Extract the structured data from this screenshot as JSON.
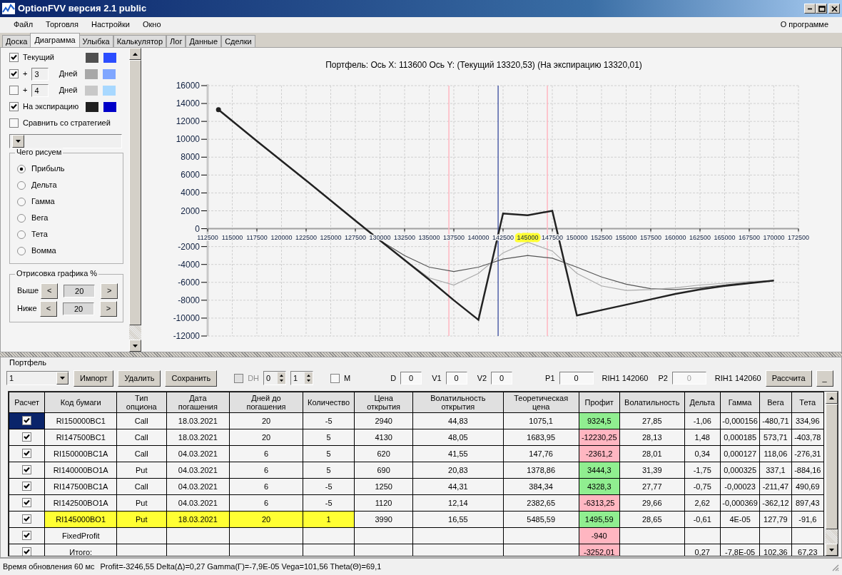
{
  "window": {
    "title": "OptionFVV версия 2.1 public"
  },
  "menu": [
    "Файл",
    "Торговля",
    "Настройки",
    "Окно"
  ],
  "menu_right": "О программе",
  "tabs": [
    {
      "label": "Доска",
      "selected": false
    },
    {
      "label": "Диаграмма",
      "selected": true
    },
    {
      "label": "Улыбка",
      "selected": false
    },
    {
      "label": "Калькулятор",
      "selected": false
    },
    {
      "label": "Лог",
      "selected": false
    },
    {
      "label": "Данные",
      "selected": false
    },
    {
      "label": "Сделки",
      "selected": false
    }
  ],
  "panel": {
    "rows": [
      {
        "kind": "series",
        "label": "Текущий",
        "checked": true,
        "swatches": [
          {
            "color": "#505050"
          },
          {
            "color": "#2b4dff"
          }
        ]
      },
      {
        "kind": "days",
        "prefix": "+",
        "days": "3",
        "label": "Дней",
        "checked": true,
        "swatches": [
          {
            "color": "#a8a8a8"
          },
          {
            "color": "#7fa6ff"
          }
        ]
      },
      {
        "kind": "days",
        "prefix": "+",
        "days": "4",
        "label": "Дней",
        "checked": false,
        "swatches": [
          {
            "color": "#c8c8c8"
          },
          {
            "color": "#a8d8ff"
          }
        ]
      },
      {
        "kind": "series",
        "label": "На экспирацию",
        "checked": true,
        "swatches": [
          {
            "color": "#202020"
          },
          {
            "color": "#0000c8"
          }
        ]
      },
      {
        "kind": "plain",
        "label": "Сравнить со стратегией",
        "checked": false
      }
    ],
    "draw_group": {
      "title": "Чего рисуем",
      "options": [
        {
          "label": "Прибыль",
          "selected": true
        },
        {
          "label": "Дельта",
          "selected": false
        },
        {
          "label": "Гамма",
          "selected": false
        },
        {
          "label": "Вега",
          "selected": false
        },
        {
          "label": "Тета",
          "selected": false
        },
        {
          "label": "Вомма",
          "selected": false
        }
      ]
    },
    "range_group": {
      "title": "Отрисовка графика %",
      "rows": [
        {
          "label": "Выше",
          "dec": "<",
          "value": "20",
          "inc": ">"
        },
        {
          "label": "Ниже",
          "dec": "<",
          "value": "20",
          "inc": ">"
        }
      ]
    }
  },
  "chart": {
    "chart_data": {
      "type": "line",
      "title": "Портфель: Ось X: 113600 Ось Y: (Текущий 13320,53) (На экспирацию 13320,01)",
      "x": [
        113600,
        117500,
        122500,
        127500,
        130000,
        132500,
        135000,
        137500,
        140000,
        142500,
        145000,
        147500,
        150000,
        152500,
        155000,
        157500,
        160000,
        162500,
        165000,
        167500,
        170000
      ],
      "series": [
        {
          "color": "#555555",
          "values": [
            13300,
            9800,
            5400,
            900,
            -1300,
            -3000,
            -4300,
            -4800,
            -4300,
            -3400,
            -3000,
            -3300,
            -4300,
            -5400,
            -6200,
            -6700,
            -6800,
            -6600,
            -6300,
            -6000,
            -5800
          ]
        },
        {
          "color": "#aaaaaa",
          "values": [
            13300,
            9800,
            5400,
            900,
            -1300,
            -3500,
            -5500,
            -6300,
            -5000,
            -2700,
            -1500,
            -2500,
            -5000,
            -6400,
            -6900,
            -6800,
            -6600,
            -6300,
            -6100,
            -5900,
            -5800
          ]
        },
        {
          "color": "#222222",
          "values": [
            13300,
            9800,
            5400,
            900,
            -1300,
            -3500,
            -5700,
            -8000,
            -10200,
            1700,
            1500,
            2000,
            -9700,
            -9100,
            -8500,
            -7900,
            -7300,
            -6800,
            -6400,
            -6100,
            -5800
          ]
        }
      ],
      "xlim": [
        112500,
        172500
      ],
      "ylim": [
        -12000,
        16000
      ],
      "xticks": [
        112500,
        115000,
        117500,
        120000,
        122500,
        125000,
        127500,
        130000,
        132500,
        135000,
        137500,
        140000,
        142500,
        145000,
        147500,
        150000,
        152500,
        155000,
        157500,
        160000,
        162500,
        165000,
        167500,
        170000,
        172500
      ],
      "yticks": [
        -12000,
        -10000,
        -8000,
        -6000,
        -4000,
        -2000,
        0,
        2000,
        4000,
        6000,
        8000,
        10000,
        12000,
        14000,
        16000
      ],
      "grid": true,
      "ref_lines": [
        {
          "axis": "x",
          "value": 137000,
          "color": "#ffb6c1"
        },
        {
          "axis": "x",
          "value": 142000,
          "color": "#5060a8"
        },
        {
          "axis": "x",
          "value": 147000,
          "color": "#ffb6c1"
        }
      ]
    }
  },
  "portfolio": {
    "title": "Портфель",
    "items": [
      {
        "kind": "select",
        "value": "1"
      },
      {
        "kind": "button",
        "label": "Импорт"
      },
      {
        "kind": "button",
        "label": "Удалить"
      },
      {
        "kind": "button",
        "label": "Сохранить"
      },
      {
        "kind": "checkbox",
        "label": "DH",
        "checked": false,
        "disabled": true
      },
      {
        "kind": "spinner",
        "value": "0"
      },
      {
        "kind": "spinner",
        "value": "1"
      },
      {
        "kind": "checkbox",
        "label": "M",
        "checked": false,
        "disabled": false
      },
      {
        "kind": "field",
        "label": "D",
        "value": "0",
        "disabled": false
      },
      {
        "kind": "field",
        "label": "V1",
        "value": "0",
        "disabled": false
      },
      {
        "kind": "field",
        "label": "V2",
        "value": "0",
        "disabled": false
      },
      {
        "kind": "field",
        "label": "P1",
        "value": "0",
        "disabled": false
      },
      {
        "kind": "text",
        "text": "RIH1 142060"
      },
      {
        "kind": "field",
        "label": "P2",
        "value": "0",
        "disabled": true
      },
      {
        "kind": "text",
        "text": "RIH1 142060"
      },
      {
        "kind": "button",
        "label": "Рассчита"
      },
      {
        "kind": "button",
        "label": "_"
      }
    ]
  },
  "table": {
    "columns": [
      "Расчет",
      "Код бумаги",
      "Тип\nопциона",
      "Дата\nпогашения",
      "Дней до\nпогашения",
      "Количество",
      "Цена\nоткрытия",
      "Волатильность\nоткрытия",
      "Теоретическая\nцена",
      "Профит",
      "Волатильность",
      "Дельта",
      "Гамма",
      "Вега",
      "Тета"
    ],
    "rows": [
      {
        "calc": true,
        "selected": true,
        "highlighted": false,
        "code": "RI150000BC1",
        "type": "Call",
        "expiry": "18.03.2021",
        "days": "20",
        "qty": "-5",
        "open_price": "2940",
        "open_vol": "44,83",
        "theo": "1075,1",
        "profit": "9324,5",
        "color": "#90ee90",
        "vol": "27,85",
        "delta": "-1,06",
        "gamma": "-0,000156",
        "vega": "-480,71",
        "theta": "334,96"
      },
      {
        "calc": true,
        "selected": false,
        "highlighted": false,
        "code": "RI147500BC1",
        "type": "Call",
        "expiry": "18.03.2021",
        "days": "20",
        "qty": "5",
        "open_price": "4130",
        "open_vol": "48,05",
        "theo": "1683,95",
        "profit": "-12230,25",
        "color": "#ffb6c1",
        "vol": "28,13",
        "delta": "1,48",
        "gamma": "0,000185",
        "vega": "573,71",
        "theta": "-403,78"
      },
      {
        "calc": true,
        "selected": false,
        "highlighted": false,
        "code": "RI150000BC1A",
        "type": "Call",
        "expiry": "04.03.2021",
        "days": "6",
        "qty": "5",
        "open_price": "620",
        "open_vol": "41,55",
        "theo": "147,76",
        "profit": "-2361,2",
        "color": "#ffb6c1",
        "vol": "28,01",
        "delta": "0,34",
        "gamma": "0,000127",
        "vega": "118,06",
        "theta": "-276,31"
      },
      {
        "calc": true,
        "selected": false,
        "highlighted": false,
        "code": "RI140000BO1A",
        "type": "Put",
        "expiry": "04.03.2021",
        "days": "6",
        "qty": "5",
        "open_price": "690",
        "open_vol": "20,83",
        "theo": "1378,86",
        "profit": "3444,3",
        "color": "#90ee90",
        "vol": "31,39",
        "delta": "-1,75",
        "gamma": "0,000325",
        "vega": "337,1",
        "theta": "-884,16"
      },
      {
        "calc": true,
        "selected": false,
        "highlighted": false,
        "code": "RI147500BC1A",
        "type": "Call",
        "expiry": "04.03.2021",
        "days": "6",
        "qty": "-5",
        "open_price": "1250",
        "open_vol": "44,31",
        "theo": "384,34",
        "profit": "4328,3",
        "color": "#90ee90",
        "vol": "27,77",
        "delta": "-0,75",
        "gamma": "-0,00023",
        "vega": "-211,47",
        "theta": "490,69"
      },
      {
        "calc": true,
        "selected": false,
        "highlighted": false,
        "code": "RI142500BO1A",
        "type": "Put",
        "expiry": "04.03.2021",
        "days": "6",
        "qty": "-5",
        "open_price": "1120",
        "open_vol": "12,14",
        "theo": "2382,65",
        "profit": "-6313,25",
        "color": "#ffb6c1",
        "vol": "29,66",
        "delta": "2,62",
        "gamma": "-0,000369",
        "vega": "-362,12",
        "theta": "897,43"
      },
      {
        "calc": true,
        "selected": false,
        "highlighted": true,
        "code": "RI145000BO1",
        "type": "Put",
        "expiry": "18.03.2021",
        "days": "20",
        "qty": "1",
        "open_price": "3990",
        "open_vol": "16,55",
        "theo": "5485,59",
        "profit": "1495,59",
        "color": "#90ee90",
        "vol": "28,65",
        "delta": "-0,61",
        "gamma": "4E-05",
        "vega": "127,79",
        "theta": "-91,6"
      },
      {
        "calc": true,
        "selected": false,
        "highlighted": false,
        "code": "FixedProfit",
        "profit": "-940",
        "color": "#ffb6c1"
      },
      {
        "calc": true,
        "selected": false,
        "highlighted": false,
        "code": "Итого:",
        "profit": "-3252,01",
        "color": "#ffb6c1",
        "delta": "0,27",
        "gamma": "-7,8E-05",
        "vega": "102,36",
        "theta": "67,23"
      }
    ]
  },
  "status_bar": [
    "Время обновления 60 мс",
    "Profit=-3246,55 Delta(Δ)=0,27 Gamma(Γ)=-7,9E-05 Vega=101,56 Theta(Θ)=69,1"
  ]
}
